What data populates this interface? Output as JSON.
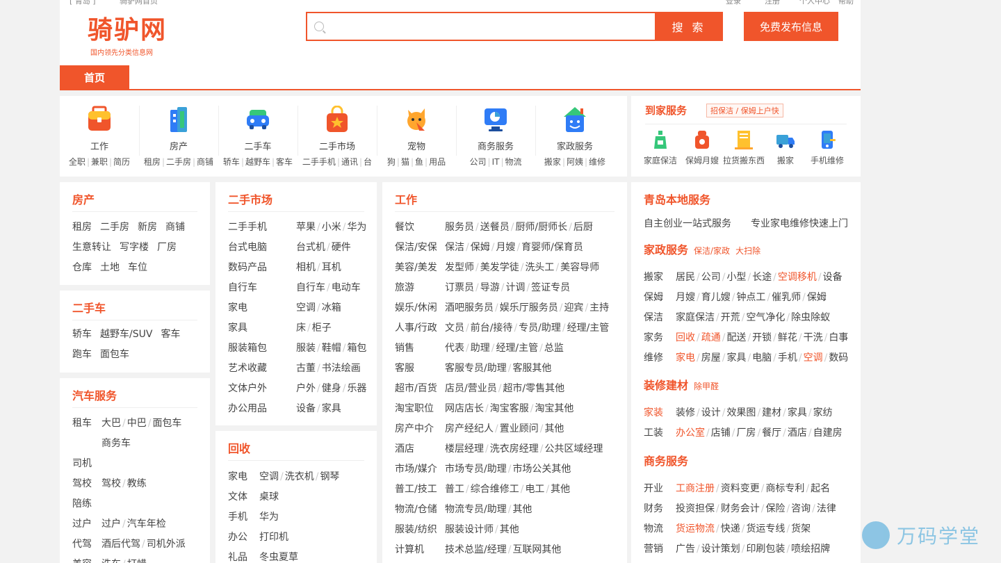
{
  "topbar": {
    "left1": "[ 青岛 ]",
    "left2": "骑驴网首页",
    "login": "登录",
    "register": "注册",
    "center": "个人中心",
    "help": "帮助"
  },
  "header": {
    "logo": "骑驴网",
    "slogan": "国内领先分类信息网",
    "search_placeholder": "",
    "search_button": "搜 索",
    "publish_button": "免费发布信息"
  },
  "nav": {
    "home": "首页"
  },
  "categories": [
    {
      "label": "工作",
      "icon": "briefcase-icon",
      "subs": [
        "全职",
        "兼职",
        "简历"
      ]
    },
    {
      "label": "房产",
      "icon": "building-icon",
      "subs": [
        "租房",
        "二手房",
        "商铺"
      ]
    },
    {
      "label": "二手车",
      "icon": "car-icon",
      "subs": [
        "轿车",
        "越野车",
        "客车"
      ]
    },
    {
      "label": "二手市场",
      "icon": "shopping-bag-icon",
      "subs": [
        "二手手机",
        "通讯",
        "台"
      ]
    },
    {
      "label": "宠物",
      "icon": "pet-icon",
      "subs": [
        "狗",
        "猫",
        "鱼",
        "用品"
      ]
    },
    {
      "label": "商务服务",
      "icon": "business-chart-icon",
      "subs": [
        "公司",
        "IT",
        "物流"
      ]
    },
    {
      "label": "家政服务",
      "icon": "house-icon",
      "subs": [
        "搬家",
        "阿姨",
        "维修"
      ]
    }
  ],
  "home_service": {
    "title": "到家服务",
    "tag": "招保洁 / 保姆上户快",
    "items": [
      {
        "label": "家庭保洁",
        "icon": "cleaning-bottle-icon"
      },
      {
        "label": "保姆月嫂",
        "icon": "nanny-icon"
      },
      {
        "label": "拉货搬东西",
        "icon": "cargo-icon"
      },
      {
        "label": "搬家",
        "icon": "truck-icon"
      },
      {
        "label": "手机维修",
        "icon": "phone-repair-icon"
      }
    ]
  },
  "house": {
    "title": "房产",
    "rows": [
      [
        "租房",
        "二手房",
        "新房",
        "商铺"
      ],
      [
        "生意转让",
        "写字楼",
        "厂房"
      ],
      [
        "仓库",
        "土地",
        "车位"
      ]
    ]
  },
  "usedcar": {
    "title": "二手车",
    "rows": [
      [
        "轿车",
        "越野车/SUV",
        "客车"
      ],
      [
        "跑车",
        "面包车"
      ]
    ]
  },
  "carsvc": {
    "title": "汽车服务",
    "rows": [
      {
        "k": "租车",
        "items": [
          "大巴",
          "中巴",
          "面包车"
        ]
      },
      {
        "k": "",
        "items": [
          "商务车"
        ]
      },
      {
        "k": "司机",
        "items": []
      },
      {
        "k": "驾校",
        "items": [
          "驾校",
          "教练"
        ]
      },
      {
        "k": "陪练",
        "items": []
      },
      {
        "k": "过户",
        "items": [
          "过户",
          "汽车年检"
        ]
      },
      {
        "k": "代驾",
        "items": [
          "酒后代驾",
          "司机外派"
        ]
      },
      {
        "k": "美容",
        "items": [
          "洗车",
          "打蜡"
        ]
      }
    ]
  },
  "market": {
    "title": "二手市场",
    "rows": [
      {
        "k": "二手手机",
        "items": [
          "苹果",
          "小米",
          "华为"
        ]
      },
      {
        "k": "台式电脑",
        "items": [
          "台式机",
          "硬件"
        ]
      },
      {
        "k": "数码产品",
        "items": [
          "相机",
          "耳机"
        ]
      },
      {
        "k": "自行车",
        "items": [
          "自行车",
          "电动车"
        ]
      },
      {
        "k": "家电",
        "items": [
          "空调",
          "冰箱"
        ]
      },
      {
        "k": "家具",
        "items": [
          "床",
          "柜子"
        ]
      },
      {
        "k": "服装箱包",
        "items": [
          "服装",
          "鞋帽",
          "箱包"
        ]
      },
      {
        "k": "艺术收藏",
        "items": [
          "古董",
          "书法绘画"
        ]
      },
      {
        "k": "文体户外",
        "items": [
          "户外",
          "健身",
          "乐器"
        ]
      },
      {
        "k": "办公用品",
        "items": [
          "设备",
          "家具"
        ]
      }
    ]
  },
  "recycle": {
    "title": "回收",
    "rows": [
      {
        "k": "家电",
        "items": [
          "空调",
          "洗衣机",
          "钢琴"
        ]
      },
      {
        "k": "文体",
        "items": [
          "桌球"
        ]
      },
      {
        "k": "手机",
        "items": [
          "华为"
        ]
      },
      {
        "k": "办公",
        "items": [
          "打印机"
        ]
      },
      {
        "k": "礼品",
        "items": [
          "冬虫夏草"
        ]
      }
    ]
  },
  "job": {
    "title": "工作",
    "rows": [
      {
        "k": "餐饮",
        "items": [
          "服务员",
          "送餐员",
          "厨师/厨师长",
          "后厨"
        ]
      },
      {
        "k": "保洁/安保",
        "items": [
          "保洁",
          "保姆",
          "月嫂",
          "育婴师/保育员"
        ]
      },
      {
        "k": "美容/美发",
        "items": [
          "发型师",
          "美发学徒",
          "洗头工",
          "美容导师"
        ]
      },
      {
        "k": "旅游",
        "items": [
          "订票员",
          "导游",
          "计调",
          "签证专员"
        ]
      },
      {
        "k": "娱乐/休闲",
        "items": [
          "酒吧服务员",
          "娱乐厅服务员",
          "迎宾",
          "主持"
        ]
      },
      {
        "k": "人事/行政",
        "items": [
          "文员",
          "前台/接待",
          "专员/助理",
          "经理/主管"
        ]
      },
      {
        "k": "销售",
        "items": [
          "代表",
          "助理",
          "经理/主管",
          "总监"
        ]
      },
      {
        "k": "客服",
        "items": [
          "客服专员/助理",
          "客服其他"
        ]
      },
      {
        "k": "超市/百货",
        "items": [
          "店员/营业员",
          "超市/零售其他"
        ]
      },
      {
        "k": "淘宝职位",
        "items": [
          "网店店长",
          "淘宝客服",
          "淘宝其他"
        ]
      },
      {
        "k": "房产中介",
        "items": [
          "房产经纪人",
          "置业顾问",
          "其他"
        ]
      },
      {
        "k": "酒店",
        "items": [
          "楼层经理",
          "洗衣房经理",
          "公共区域经理"
        ]
      },
      {
        "k": "市场/媒介",
        "items": [
          "市场专员/助理",
          "市场公关其他"
        ]
      },
      {
        "k": "普工/技工",
        "items": [
          "普工",
          "综合维修工",
          "电工",
          "其他"
        ]
      },
      {
        "k": "物流/仓储",
        "items": [
          "物流专员/助理",
          "其他"
        ]
      },
      {
        "k": "服装/纺织",
        "items": [
          "服装设计师",
          "其他"
        ]
      },
      {
        "k": "计算机",
        "items": [
          "技术总监/经理",
          "互联网其他"
        ]
      }
    ]
  },
  "local": {
    "title": "青岛本地服务",
    "top_links": [
      "自主创业一站式服务",
      "专业家电维修快速上门"
    ],
    "housekeeping": {
      "title": "家政服务",
      "tags": [
        "保洁/家政",
        "大扫除"
      ],
      "rows": [
        {
          "k": "搬家",
          "items": [
            {
              "t": "居民"
            },
            {
              "t": "公司"
            },
            {
              "t": "小型"
            },
            {
              "t": "长途"
            },
            {
              "t": "空调移机",
              "red": true
            },
            {
              "t": "设备"
            }
          ]
        },
        {
          "k": "保姆",
          "items": [
            {
              "t": "月嫂"
            },
            {
              "t": "育儿嫂"
            },
            {
              "t": "钟点工"
            },
            {
              "t": "催乳师"
            },
            {
              "t": "保姆"
            }
          ]
        },
        {
          "k": "保洁",
          "items": [
            {
              "t": "家庭保洁"
            },
            {
              "t": "开荒"
            },
            {
              "t": "空气净化"
            },
            {
              "t": "除虫除蚁"
            }
          ]
        },
        {
          "k": "家务",
          "items": [
            {
              "t": "回收",
              "red": true
            },
            {
              "t": "疏通",
              "red": true
            },
            {
              "t": "配送"
            },
            {
              "t": "开锁"
            },
            {
              "t": "鲜花"
            },
            {
              "t": "干洗"
            },
            {
              "t": "白事"
            }
          ]
        },
        {
          "k": "维修",
          "items": [
            {
              "t": "家电",
              "red": true
            },
            {
              "t": "房屋"
            },
            {
              "t": "家具"
            },
            {
              "t": "电脑"
            },
            {
              "t": "手机"
            },
            {
              "t": "空调",
              "red": true
            },
            {
              "t": "数码"
            }
          ]
        }
      ]
    },
    "decor": {
      "title": "装修建材",
      "tags": [
        "除甲醛"
      ],
      "rows": [
        {
          "k": "家装",
          "kred": true,
          "items": [
            {
              "t": "装修"
            },
            {
              "t": "设计"
            },
            {
              "t": "效果图"
            },
            {
              "t": "建材"
            },
            {
              "t": "家具"
            },
            {
              "t": "家纺"
            }
          ]
        },
        {
          "k": "工装",
          "items": [
            {
              "t": "办公室",
              "red": true
            },
            {
              "t": "店铺"
            },
            {
              "t": "厂房"
            },
            {
              "t": "餐厅"
            },
            {
              "t": "酒店"
            },
            {
              "t": "自建房"
            }
          ]
        }
      ]
    },
    "business": {
      "title": "商务服务",
      "rows": [
        {
          "k": "开业",
          "items": [
            {
              "t": "工商注册",
              "red": true
            },
            {
              "t": "资料变更"
            },
            {
              "t": "商标专利"
            },
            {
              "t": "起名"
            }
          ]
        },
        {
          "k": "财务",
          "items": [
            {
              "t": "投资担保"
            },
            {
              "t": "财务会计"
            },
            {
              "t": "保险"
            },
            {
              "t": "咨询"
            },
            {
              "t": "法律"
            }
          ]
        },
        {
          "k": "物流",
          "items": [
            {
              "t": "货运物流",
              "red": true
            },
            {
              "t": "快递"
            },
            {
              "t": "货运专线"
            },
            {
              "t": "货架"
            }
          ]
        },
        {
          "k": "营销",
          "items": [
            {
              "t": "广告"
            },
            {
              "t": "设计策划"
            },
            {
              "t": "印刷包装"
            },
            {
              "t": "喷绘招牌"
            }
          ]
        }
      ]
    }
  },
  "watermark": {
    "text": "万码学堂"
  },
  "colors": {
    "accent": "#f0552b",
    "watermark": "#3aa1d8"
  }
}
